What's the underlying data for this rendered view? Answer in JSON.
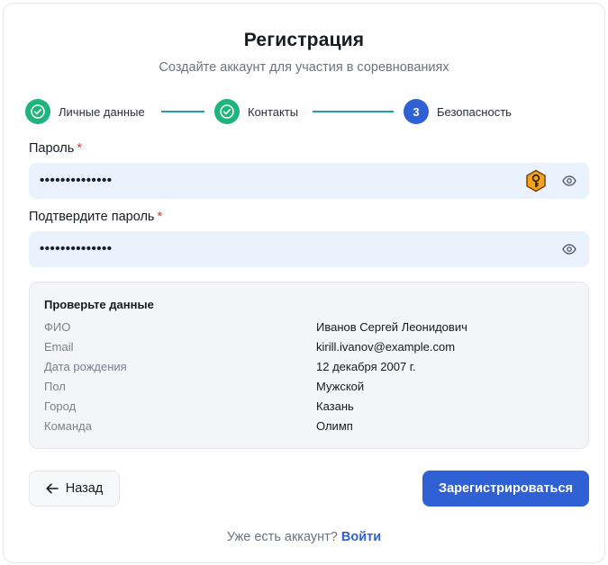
{
  "header": {
    "title": "Регистрация",
    "subtitle": "Создайте аккаунт для участия в соревнованиях"
  },
  "steps": [
    {
      "label": "Личные данные",
      "state": "done",
      "icon": "check-icon"
    },
    {
      "label": "Контакты",
      "state": "done",
      "icon": "check-icon"
    },
    {
      "label": "Безопасность",
      "state": "active",
      "number": "3"
    }
  ],
  "password": {
    "label": "Пароль",
    "required_mark": "*",
    "value": "••••••••••••••",
    "icons": [
      "key-badge-icon",
      "eye-icon"
    ]
  },
  "confirm_password": {
    "label": "Подтвердите пароль",
    "required_mark": "*",
    "value": "••••••••••••••",
    "icons": [
      "eye-icon"
    ]
  },
  "review": {
    "title": "Проверьте данные",
    "rows": [
      {
        "key": "ФИО",
        "value": "Иванов Сергей Леонидович"
      },
      {
        "key": "Email",
        "value": "kirill.ivanov@example.com"
      },
      {
        "key": "Дата рождения",
        "value": "12 декабря 2007 г."
      },
      {
        "key": "Пол",
        "value": "Мужской"
      },
      {
        "key": "Город",
        "value": "Казань"
      },
      {
        "key": "Команда",
        "value": "Олимп"
      }
    ]
  },
  "actions": {
    "back_label": "Назад",
    "submit_label": "Зарегистрироваться"
  },
  "footer": {
    "prompt": "Уже есть аккаунт?",
    "login_link": "Войти"
  },
  "colors": {
    "primary": "#2f61d5",
    "success": "#1fb37d",
    "input_bg": "#eaf2fe",
    "required": "#e03434",
    "key_badge": "#f2a31b"
  }
}
